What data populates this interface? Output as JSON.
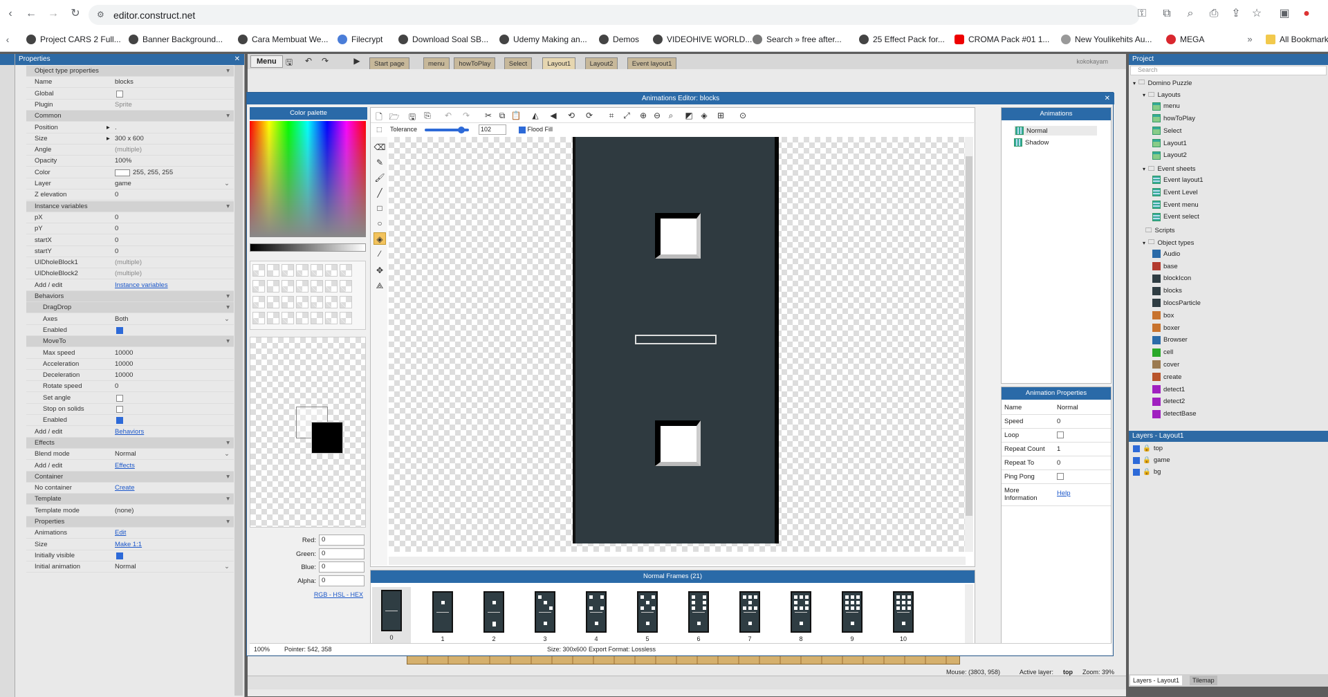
{
  "browser": {
    "url": "editor.construct.net",
    "bookmarks": [
      "Project CARS 2 Full...",
      "Banner Background...",
      "Cara Membuat We...",
      "Filecrypt",
      "Download Soal SB...",
      "Udemy Making an...",
      "Demos",
      "VIDEOHIVE WORLD...",
      "Search » free after...",
      "25 Effect Pack for...",
      "CROMA Pack #01 1...",
      "New Youlikehits Au...",
      "MEGA",
      "All Bookmarks"
    ]
  },
  "properties": {
    "title": "Properties",
    "rows": [
      {
        "k": "Object type properties",
        "sec": true
      },
      {
        "k": "Name",
        "v": "blocks"
      },
      {
        "k": "Global",
        "cb": false
      },
      {
        "k": "Plugin",
        "v": "Sprite",
        "dim": true
      },
      {
        "k": "Common",
        "sec": true
      },
      {
        "k": "Position",
        "v": "."
      },
      {
        "k": "Size",
        "v": "300 x 600"
      },
      {
        "k": "Angle",
        "v": "(multiple)",
        "dim": true
      },
      {
        "k": "Opacity",
        "v": "100%"
      },
      {
        "k": "Color",
        "v": "255, 255, 255"
      },
      {
        "k": "Layer",
        "v": "game"
      },
      {
        "k": "Z elevation",
        "v": "0"
      },
      {
        "k": "Instance variables",
        "sec": true
      },
      {
        "k": "pX",
        "v": "0"
      },
      {
        "k": "pY",
        "v": "0"
      },
      {
        "k": "startX",
        "v": "0"
      },
      {
        "k": "startY",
        "v": "0"
      },
      {
        "k": "UIDholeBlock1",
        "v": "(multiple)",
        "dim": true
      },
      {
        "k": "UIDholeBlock2",
        "v": "(multiple)",
        "dim": true
      },
      {
        "k": "Add / edit",
        "v": "Instance variables",
        "link": true
      },
      {
        "k": "Behaviors",
        "sec": true
      },
      {
        "k": "DragDrop",
        "sec": true,
        "ind": true
      },
      {
        "k": "Axes",
        "v": "Both",
        "ind": true
      },
      {
        "k": "Enabled",
        "cb": true,
        "ind": true
      },
      {
        "k": "MoveTo",
        "sec": true,
        "ind": true
      },
      {
        "k": "Max speed",
        "v": "10000",
        "ind": true
      },
      {
        "k": "Acceleration",
        "v": "10000",
        "ind": true
      },
      {
        "k": "Deceleration",
        "v": "10000",
        "ind": true
      },
      {
        "k": "Rotate speed",
        "v": "0",
        "ind": true
      },
      {
        "k": "Set angle",
        "cb": false,
        "ind": true
      },
      {
        "k": "Stop on solids",
        "cb": false,
        "ind": true
      },
      {
        "k": "Enabled",
        "cb": true,
        "ind": true
      },
      {
        "k": "Add / edit",
        "v": "Behaviors",
        "link": true
      },
      {
        "k": "Effects",
        "sec": true
      },
      {
        "k": "Blend mode",
        "v": "Normal"
      },
      {
        "k": "Add / edit",
        "v": "Effects",
        "link": true
      },
      {
        "k": "Container",
        "sec": true
      },
      {
        "k": "No container",
        "v": "Create",
        "link": true
      },
      {
        "k": "Template",
        "sec": true
      },
      {
        "k": "Template mode",
        "v": "(none)"
      },
      {
        "k": "Properties",
        "sec": true
      },
      {
        "k": "Animations",
        "v": "Edit",
        "link": true
      },
      {
        "k": "Size",
        "v": "Make 1:1",
        "link": true
      },
      {
        "k": "Initially visible",
        "cb": true
      },
      {
        "k": "Initial animation",
        "v": "Normal"
      }
    ]
  },
  "toolbar": {
    "menu": "Menu",
    "tabs": [
      "Start page",
      "menu",
      "howToPlay",
      "Select",
      "Layout1",
      "Layout2",
      "Event layout1"
    ],
    "user": "kokokayam"
  },
  "dialog": {
    "title": "Animations Editor: blocks",
    "palette_title": "Color palette",
    "animations_title": "Animations",
    "animations": [
      "Normal",
      "Shadow"
    ],
    "tolerance_label": "Tolerance",
    "tolerance": "102",
    "flood_fill": "Flood Fill",
    "rgb": [
      {
        "k": "Red:",
        "v": "0"
      },
      {
        "k": "Green:",
        "v": "0"
      },
      {
        "k": "Blue:",
        "v": "0"
      },
      {
        "k": "Alpha:",
        "v": "0"
      }
    ],
    "color_links": "RGB - HSL - HEX",
    "anim_props_title": "Animation Properties",
    "anim_props": [
      {
        "k": "Name",
        "v": "Normal"
      },
      {
        "k": "Speed",
        "v": "0"
      },
      {
        "k": "Loop",
        "cb": false
      },
      {
        "k": "Repeat Count",
        "v": "1"
      },
      {
        "k": "Repeat To",
        "v": "0"
      },
      {
        "k": "Ping Pong",
        "cb": false
      },
      {
        "k": "More Information",
        "v": "Help",
        "link": true
      }
    ],
    "frames_title": "Normal Frames (21)",
    "frames": [
      "0",
      "1",
      "2",
      "3",
      "4",
      "5",
      "6",
      "7",
      "8",
      "9",
      "10"
    ],
    "status": {
      "zoom": "100%",
      "pointer": "Pointer: 542, 358",
      "size": "Size: 300x600",
      "export": "Export Format: Lossless"
    }
  },
  "project": {
    "title": "Project",
    "search": "Search",
    "tree": [
      {
        "t": "Domino Puzzle",
        "l": 0,
        "ic": "folder"
      },
      {
        "t": "Layouts",
        "l": 1,
        "ic": "folder"
      },
      {
        "t": "menu",
        "l": 2,
        "ic": "layout"
      },
      {
        "t": "howToPlay",
        "l": 2,
        "ic": "layout"
      },
      {
        "t": "Select",
        "l": 2,
        "ic": "layout"
      },
      {
        "t": "Layout1",
        "l": 2,
        "ic": "layout"
      },
      {
        "t": "Layout2",
        "l": 2,
        "ic": "layout"
      },
      {
        "t": "Event sheets",
        "l": 1,
        "ic": "folder"
      },
      {
        "t": "Event layout1",
        "l": 2,
        "ic": "event"
      },
      {
        "t": "Event Level",
        "l": 2,
        "ic": "event"
      },
      {
        "t": "Event menu",
        "l": 2,
        "ic": "event"
      },
      {
        "t": "Event select",
        "l": 2,
        "ic": "event"
      },
      {
        "t": "Scripts",
        "l": 1,
        "ic": "folder"
      },
      {
        "t": "Object types",
        "l": 1,
        "ic": "folder"
      },
      {
        "t": "Audio",
        "l": 2,
        "c": "#2a6aa8"
      },
      {
        "t": "base",
        "l": 2,
        "c": "#b33a2e"
      },
      {
        "t": "blockIcon",
        "l": 2,
        "c": "#2f3d43"
      },
      {
        "t": "blocks",
        "l": 2,
        "c": "#2f3d43"
      },
      {
        "t": "blocsParticle",
        "l": 2,
        "c": "#2f3d43"
      },
      {
        "t": "box",
        "l": 2,
        "c": "#c8732e"
      },
      {
        "t": "boxer",
        "l": 2,
        "c": "#c8732e"
      },
      {
        "t": "Browser",
        "l": 2,
        "c": "#2a6aa8"
      },
      {
        "t": "cell",
        "l": 2,
        "c": "#29a829"
      },
      {
        "t": "cover",
        "l": 2,
        "c": "#9b7a50"
      },
      {
        "t": "create",
        "l": 2,
        "c": "#b8542b"
      },
      {
        "t": "detect1",
        "l": 2,
        "c": "#a020c0"
      },
      {
        "t": "detect2",
        "l": 2,
        "c": "#a020c0"
      },
      {
        "t": "detectBase",
        "l": 2,
        "c": "#a020c0"
      }
    ]
  },
  "layers": {
    "title": "Layers - Layout1",
    "items": [
      "top",
      "game",
      "bg"
    ],
    "tabs": [
      "Layers - Layout1",
      "Tilemap"
    ]
  },
  "statusbar": {
    "mouse": "Mouse: (3803, 958)",
    "active_layer": "Active layer:",
    "active_value": "top",
    "zoom": "Zoom: 39%"
  }
}
